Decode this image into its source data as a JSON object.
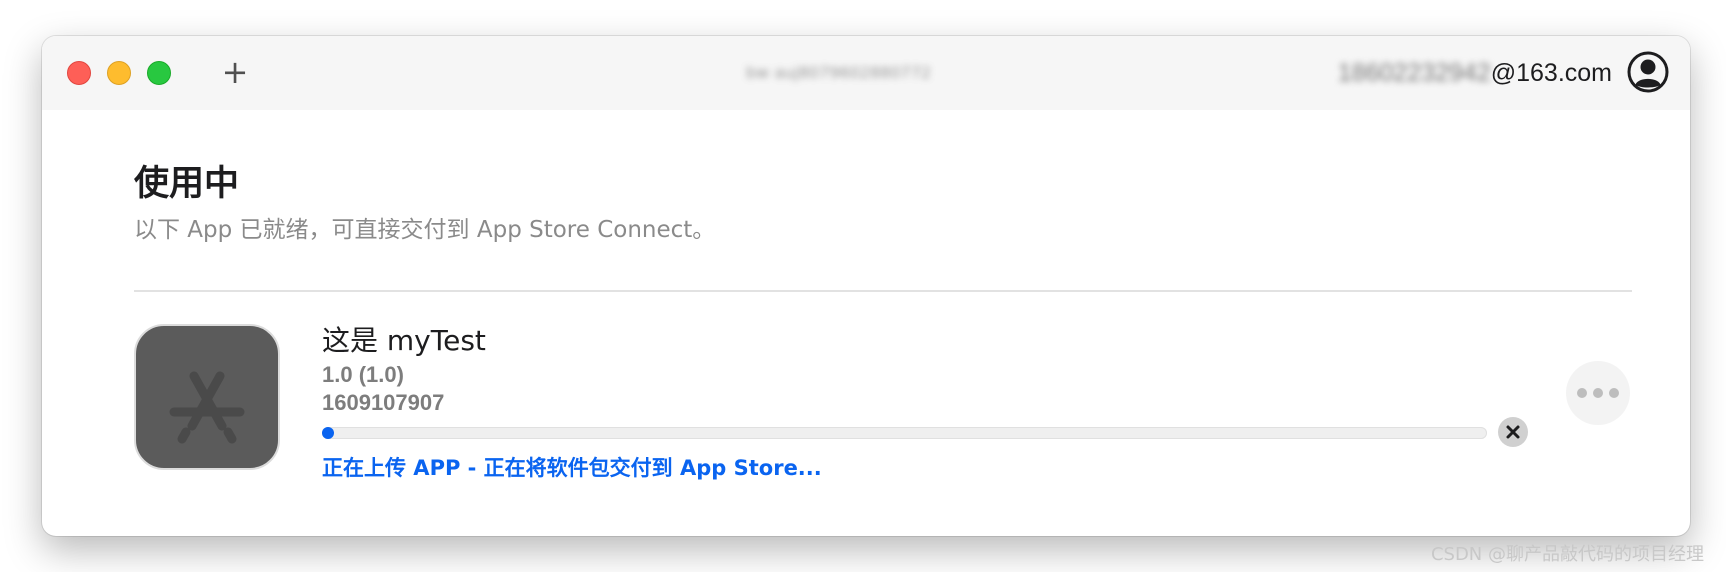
{
  "window": {
    "title_obscured": "bw auj8079602880772",
    "account_obscured": "18602232942",
    "account_visible": "@163.com",
    "icons": {
      "close": "close-window-icon",
      "minimize": "minimize-window-icon",
      "maximize": "maximize-window-icon",
      "add": "plus-icon",
      "account": "account-icon"
    },
    "plus_label": "+"
  },
  "section": {
    "title": "使用中",
    "subtitle": "以下 App 已就绪，可直接交付到 App Store Connect。"
  },
  "app": {
    "name": "这是 myTest",
    "version": "1.0 (1.0)",
    "id": "1609107907",
    "icon": "app-store-placeholder-icon",
    "upload_progress": 0.005,
    "status": "正在上传 APP - 正在将软件包交付到 App Store...",
    "cancel_icon": "cancel-icon",
    "more_icon": "more-options-icon"
  },
  "colors": {
    "accent": "#0a64f0",
    "close": "#fe5f57",
    "minimize": "#febc2e",
    "maximize": "#28c840",
    "titlebar": "#f6f6f6"
  },
  "watermark": "CSDN @聊产品敲代码的项目经理"
}
